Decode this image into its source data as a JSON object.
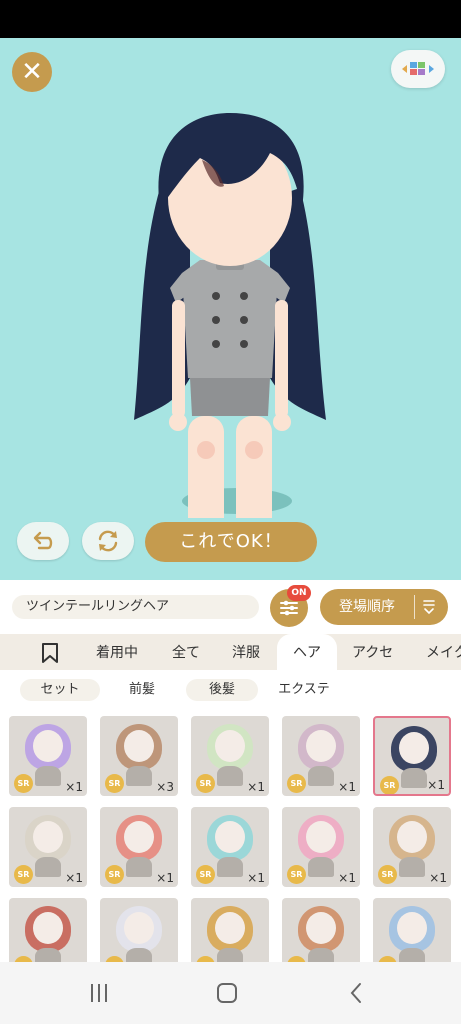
{
  "actions": {
    "close_glyph": "✕",
    "ok_label": "これでOK！"
  },
  "item_name": "ツインテールリングヘア",
  "filter": {
    "badge": "ON"
  },
  "sort": {
    "label": "登場順序"
  },
  "tabs": [
    "着用中",
    "全て",
    "洋服",
    "ヘア",
    "アクセ",
    "メイク"
  ],
  "active_tab": "ヘア",
  "subtabs": [
    "セット",
    "前髪",
    "後髪",
    "エクステ"
  ],
  "active_subtab": "前髪",
  "items": [
    {
      "rarity": "SR",
      "count": "×1",
      "hair": "#b79be6"
    },
    {
      "rarity": "SR",
      "count": "×3",
      "hair": "#b98a6a"
    },
    {
      "rarity": "SR",
      "count": "×1",
      "hair": "#cfe6c0"
    },
    {
      "rarity": "SR",
      "count": "×1",
      "hair": "#d0b2c8"
    },
    {
      "rarity": "SR",
      "count": "×1",
      "hair": "#1f2a4d",
      "selected": true
    },
    {
      "rarity": "SR",
      "count": "×1",
      "hair": "#d9d2c6"
    },
    {
      "rarity": "SR",
      "count": "×1",
      "hair": "#e88278"
    },
    {
      "rarity": "SR",
      "count": "×1",
      "hair": "#8fd6d8"
    },
    {
      "rarity": "SR",
      "count": "×1",
      "hair": "#f1a6c2"
    },
    {
      "rarity": "SR",
      "count": "×1",
      "hair": "#d5ae80"
    },
    {
      "rarity": "SR",
      "count": "",
      "hair": "#c65a4e"
    },
    {
      "rarity": "SR",
      "count": "",
      "hair": "#e4e4ee"
    },
    {
      "rarity": "SR",
      "count": "",
      "hair": "#d8a34a"
    },
    {
      "rarity": "SR",
      "count": "",
      "hair": "#cf8a60"
    },
    {
      "rarity": "SR",
      "count": "",
      "hair": "#9cc0e4"
    }
  ],
  "colors": {
    "accent": "#c59b4e",
    "stage_bg": "#a7e4e2",
    "badge": "#e74b3c",
    "selected_border": "#e4778c"
  }
}
